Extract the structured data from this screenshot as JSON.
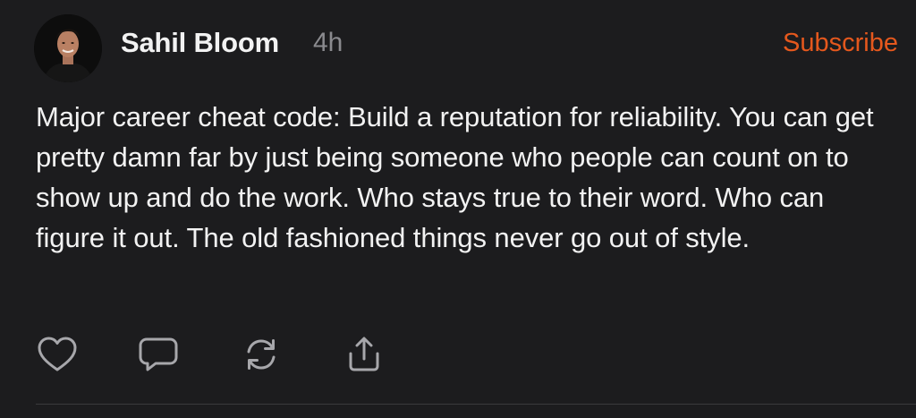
{
  "post": {
    "author": "Sahil Bloom",
    "time": "4h",
    "subscribe_label": "Subscribe",
    "body": "Major career cheat code: Build a reputation for reliability. You can get pretty damn far by just being someone who people can count on to show up and do the work. Who stays true to their word. Who can figure it out. The old fashioned things never go out of style.",
    "avatar_icon": "avatar-photo"
  },
  "actions": [
    {
      "icon": "heart-icon"
    },
    {
      "icon": "comment-icon"
    },
    {
      "icon": "restack-icon"
    },
    {
      "icon": "share-icon"
    }
  ],
  "colors": {
    "background": "#1c1c1e",
    "text": "#f2f2f2",
    "muted": "#8a8a8e",
    "accent": "#e5581d",
    "icon": "#a7a7ab"
  }
}
